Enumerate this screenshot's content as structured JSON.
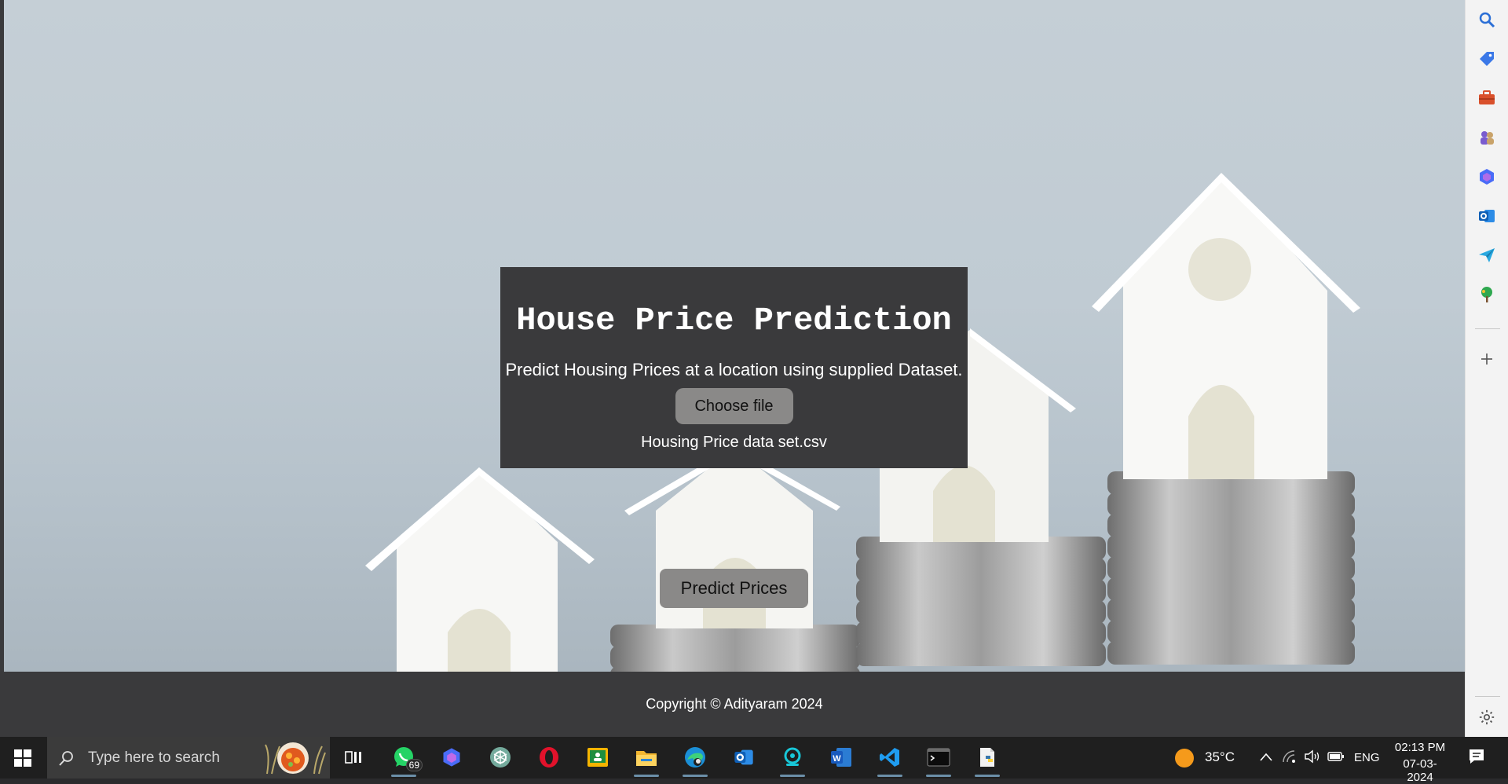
{
  "page": {
    "title": "House Price Prediction",
    "subtitle": "Predict Housing Prices at a location using supplied Dataset.",
    "file_button_label": "Choose file",
    "selected_file_name": "Housing Price data set.csv",
    "predict_button_label": "Predict Prices",
    "footer_text": "Copyright © Adityaram 2024"
  },
  "sidebar": {
    "icons": [
      "search-icon",
      "tag-icon",
      "briefcase-icon",
      "games-icon",
      "copilot-icon",
      "outlook-icon",
      "send-icon",
      "tree-icon",
      "add-icon",
      "settings-icon"
    ]
  },
  "taskbar": {
    "search_placeholder": "Type here to search",
    "apps": [
      "task-view",
      "whatsapp",
      "copilot",
      "chatgpt",
      "opera",
      "classroom",
      "file-explorer",
      "edge",
      "outlook",
      "app-cyan",
      "word",
      "vscode",
      "terminal",
      "python"
    ],
    "whatsapp_badge": "69",
    "weather_temp": "35°C",
    "language": "ENG",
    "time": "02:13 PM",
    "date": "07-03-2024"
  },
  "colors": {
    "card_bg": "#3a3a3c",
    "button_bg": "#8a8988",
    "footer_bg": "#3a3a3c",
    "taskbar_bg": "#1f1f1f"
  }
}
